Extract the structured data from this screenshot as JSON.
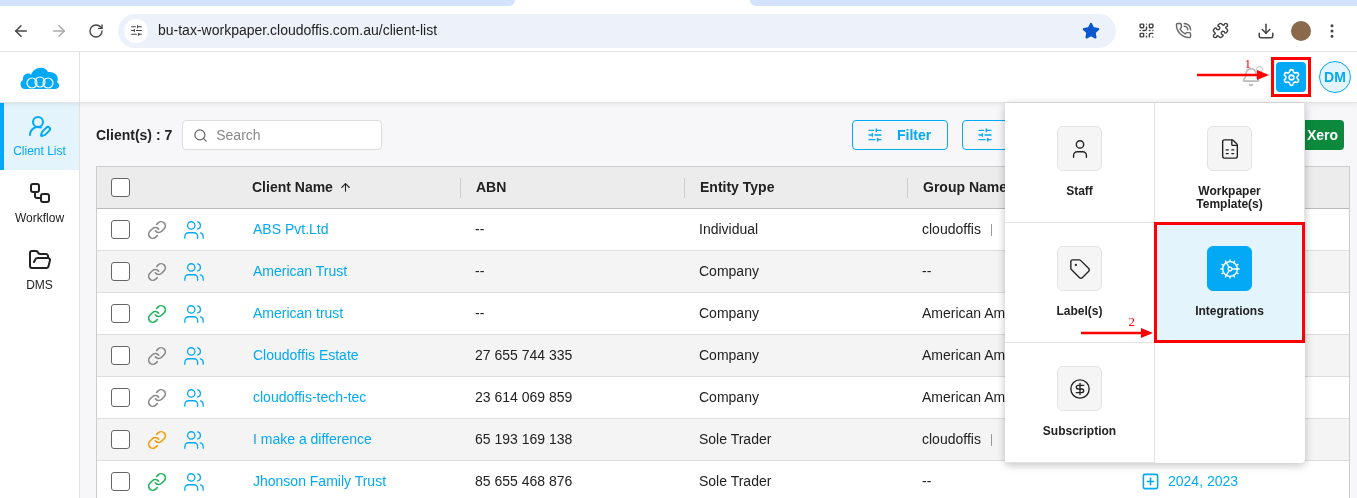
{
  "browser": {
    "url": "bu-tax-workpaper.cloudoffis.com.au/client-list"
  },
  "header": {
    "avatar": "DM",
    "settings": {
      "selected": true,
      "annotation": "1"
    }
  },
  "sidebar": {
    "items": [
      {
        "label": "Client List",
        "selected": true
      },
      {
        "label": "Workflow",
        "selected": false
      },
      {
        "label": "DMS",
        "selected": false
      }
    ]
  },
  "toolbar": {
    "count": "Client(s) : 7",
    "search": {
      "placeholder": "Search"
    },
    "buttons": [
      {
        "label": "Filter",
        "kind": "outline"
      },
      {
        "kind": "outline"
      },
      {
        "label": "Xero",
        "kind": "solid"
      }
    ]
  },
  "table": {
    "all_checked": false,
    "columns": [
      {
        "label": "Client Name",
        "sorted": true
      },
      {
        "label": "ABN",
        "sorted": false
      },
      {
        "label": "Entity Type",
        "sorted": false
      },
      {
        "label": "Group Name"
      }
    ],
    "rows": [
      {
        "checked": false,
        "color": "#8a8a8a",
        "name": "ABS Pvt.Ltd",
        "abn": "--",
        "entity": "Individual",
        "group": "cloudoffis",
        "group_separator": true
      },
      {
        "checked": false,
        "color": "#8a8a8a",
        "name": "American Trust",
        "abn": "--",
        "entity": "Company",
        "group": "--",
        "group_separator": false
      },
      {
        "checked": false,
        "color": "#22b45a",
        "name": "American trust",
        "abn": "--",
        "entity": "Company",
        "group": "American Am"
      },
      {
        "checked": false,
        "color": "#8a8a8a",
        "name": "Cloudoffis Estate",
        "abn": "27 655 744 335",
        "entity": "Company",
        "group": "American Am"
      },
      {
        "checked": false,
        "color": "#8a8a8a",
        "name": "cloudoffis-tech-tec",
        "abn": "23 614 069 859",
        "entity": "Company",
        "group": "American Am"
      },
      {
        "checked": false,
        "color": "#f59e0b",
        "name": "I make a difference",
        "abn": "65 193 169 138",
        "entity": "Sole Trader",
        "group": "cloudoffis",
        "group_separator": true
      },
      {
        "checked": false,
        "color": "#22b45a",
        "name": "Jhonson Family Trust",
        "abn": "85 655 468 876",
        "entity": "Sole Trader",
        "group": "--",
        "group_separator": false,
        "column_6": "2024, 2023"
      }
    ]
  },
  "settings_menu": {
    "items": [
      {
        "label": "Staff",
        "selected": false
      },
      {
        "label": "Workpaper Template(s)",
        "selected": false
      },
      {
        "label": "Label(s)",
        "selected": false
      },
      {
        "label": "Integrations",
        "selected": true,
        "annotation": "2"
      },
      {
        "label": "Subscription",
        "selected": false
      }
    ]
  }
}
